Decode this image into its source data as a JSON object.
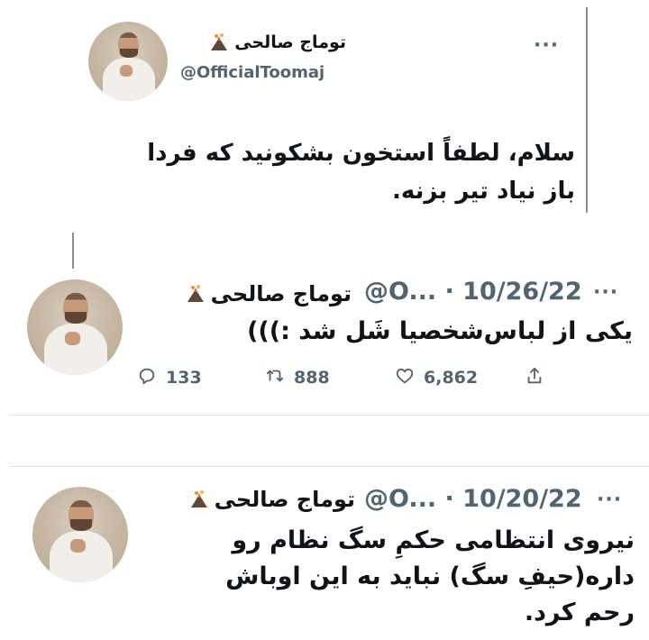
{
  "quoted_tweet": {
    "name": "توماج صالحی",
    "handle": "@OfficialToomaj",
    "text_lines": [
      "سلام، لطفاً استخون بشکونید که فردا",
      "باز نیاد تیر بزنه."
    ],
    "more": "···"
  },
  "tweet_1": {
    "name": "توماج صالحی",
    "meta": "@O... · 10/26/22",
    "text": "یکی از لباس‌شخصیا شَل شد :)))",
    "more": "···",
    "actions": {
      "replies": "133",
      "retweets": "888",
      "likes": "6,862"
    }
  },
  "tweet_2": {
    "name": "توماج صالحی",
    "meta": "@O... · 10/20/22",
    "text_lines": [
      "نیروی انتظامی حکمِ سگ نظام رو",
      "داره(حیفِ سگ) نباید به این اوباش",
      "رحم کرد."
    ],
    "more": "···"
  },
  "colors": {
    "text": "#0f1419",
    "secondary": "#536471",
    "divider": "#dfe3e6"
  },
  "icons": [
    "volcano-icon",
    "more-icon",
    "reply-icon",
    "retweet-icon",
    "like-icon",
    "share-icon"
  ]
}
